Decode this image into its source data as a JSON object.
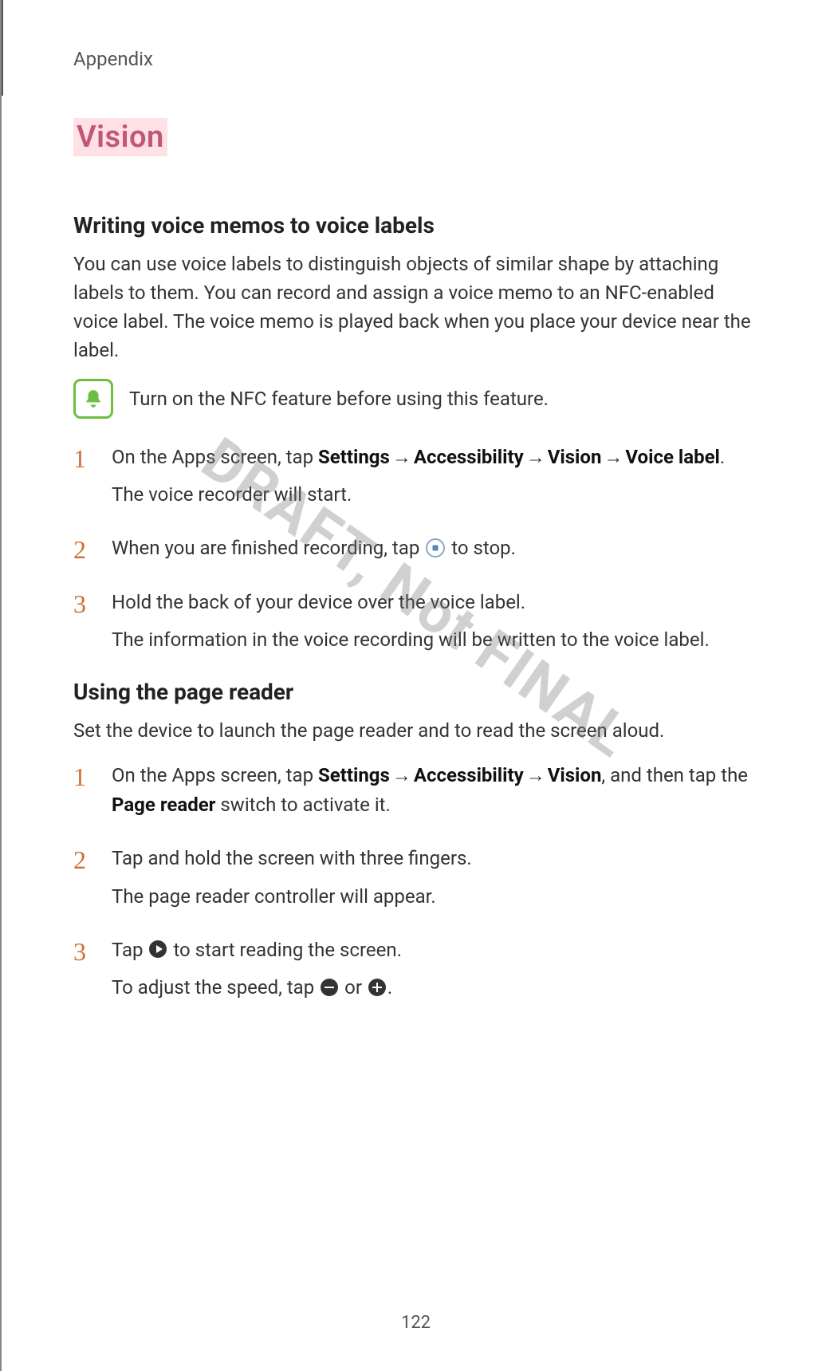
{
  "header": {
    "section": "Appendix"
  },
  "title": "Vision",
  "section1": {
    "heading": "Writing voice memos to voice labels",
    "intro": "You can use voice labels to distinguish objects of similar shape by attaching labels to them. You can record and assign a voice memo to an NFC-enabled voice label. The voice memo is played back when you place your device near the label.",
    "note": "Turn on the NFC feature before using this feature.",
    "steps": {
      "s1a": "On the Apps screen, tap ",
      "s1_settings": "Settings",
      "s1_arrow": " → ",
      "s1_access": "Accessibility",
      "s1_vision": "Vision",
      "s1_voice": "Voice label",
      "s1_period": ".",
      "s1b": "The voice recorder will start.",
      "s2a": "When you are finished recording, tap ",
      "s2b": " to stop.",
      "s3a": "Hold the back of your device over the voice label.",
      "s3b": "The information in the voice recording will be written to the voice label."
    }
  },
  "section2": {
    "heading": "Using the page reader",
    "intro": "Set the device to launch the page reader and to read the screen aloud.",
    "steps": {
      "s1a": "On the Apps screen, tap ",
      "s1_settings": "Settings",
      "s1_arrow": " → ",
      "s1_access": "Accessibility",
      "s1_vision": "Vision",
      "s1_mid": ", and then tap the ",
      "s1_page": "Page reader",
      "s1_end": " switch to activate it.",
      "s2a": "Tap and hold the screen with three fingers.",
      "s2b": "The page reader controller will appear.",
      "s3a": "Tap ",
      "s3b": " to start reading the screen.",
      "s3c": "To adjust the speed, tap ",
      "s3_or": " or ",
      "s3_end": "."
    }
  },
  "watermark": "DRAFT, Not FINAL",
  "pageNumber": "122"
}
